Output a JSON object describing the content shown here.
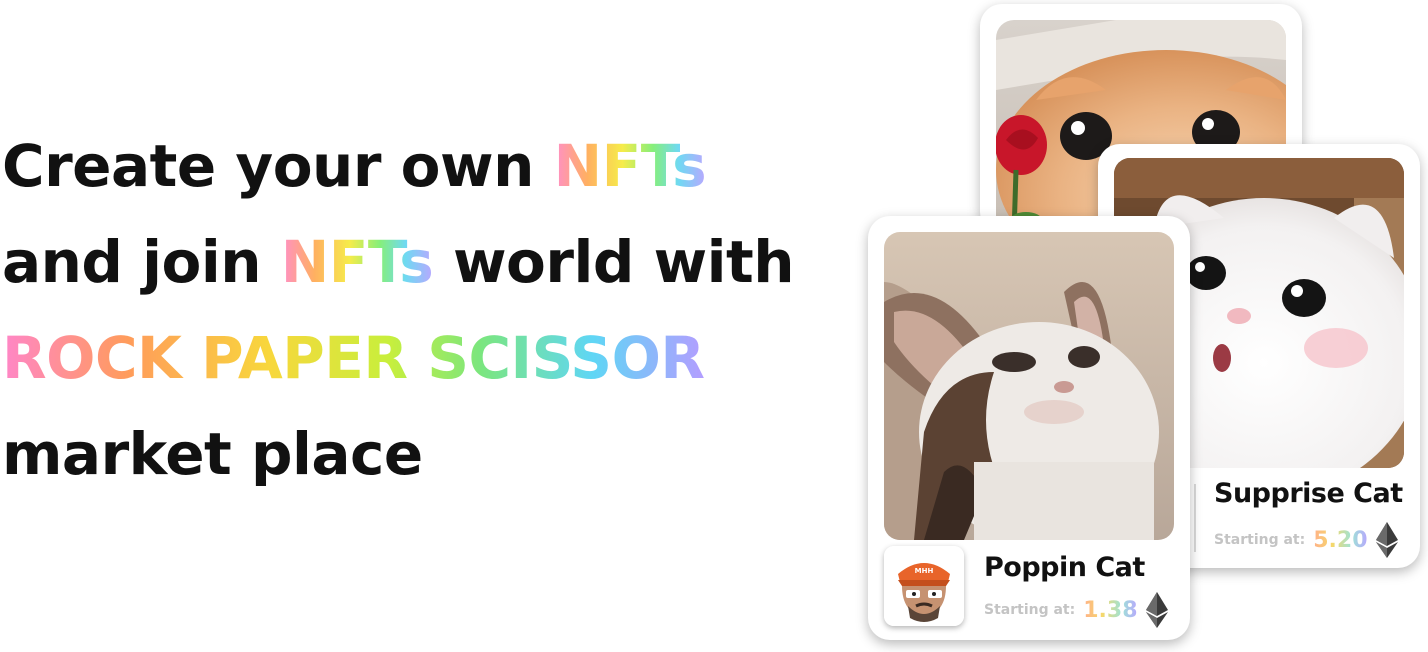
{
  "headline": {
    "line1_prefix": "Create your own ",
    "line1_highlight": "NFTs",
    "line2_prefix": "and join ",
    "line2_highlight": "NFTs",
    "line2_suffix": " world with",
    "line3_highlight": "ROCK PAPER SCISSOR",
    "line4": "market place"
  },
  "cards": [
    {
      "photo_icon": "cat-photo",
      "title": "",
      "price_label": "",
      "price_value": ""
    },
    {
      "photo_icon": "cat-photo",
      "title": "Supprise Cat",
      "price_label": "Starting at:",
      "price_value": "5.20",
      "currency_icon": "ethereum-icon"
    },
    {
      "photo_icon": "cat-photo",
      "avatar_icon": "creator-avatar",
      "title": "Poppin Cat",
      "price_label": "Starting at:",
      "price_value": "1.38",
      "currency_icon": "ethereum-icon"
    }
  ],
  "colors": {
    "text": "#111111",
    "muted": "#c4c4c4",
    "card_bg": "#ffffff"
  }
}
